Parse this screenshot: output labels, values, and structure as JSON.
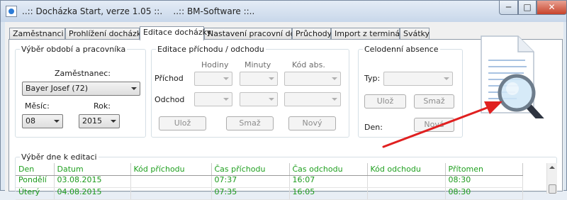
{
  "window": {
    "title": "..:: Docházka Start, verze 1.05 ::.    ..:: BM-Software ::..",
    "min_label": "─",
    "max_label": "□",
    "close_label": "✕"
  },
  "tabs": [
    {
      "label": "Zaměstnanci"
    },
    {
      "label": "Prohlížení docházky"
    },
    {
      "label": "Editace docházky",
      "active": true
    },
    {
      "label": "Nastavení pracovní doby"
    },
    {
      "label": "Průchody"
    },
    {
      "label": "Import z terminálu"
    },
    {
      "label": "Svátky"
    }
  ],
  "period_group": {
    "legend": "Výběr období a pracovníka",
    "employee_label": "Zaměstnanec:",
    "employee_value": "Bayer Josef (72)",
    "month_label": "Měsíc:",
    "month_value": "08",
    "year_label": "Rok:",
    "year_value": "2015"
  },
  "edit_group": {
    "legend": "Editace příchodu / odchodu",
    "col_hours": "Hodiny",
    "col_minutes": "Minuty",
    "col_code": "Kód abs.",
    "row_arrival": "Příchod",
    "row_departure": "Odchod",
    "save_label": "Ulož",
    "delete_label": "Smaž",
    "new_label": "Nový"
  },
  "absence_group": {
    "legend": "Celodenní absence",
    "type_label": "Typ:",
    "save_label": "Ulož",
    "delete_label": "Smaž",
    "day_label": "Den:",
    "new_label": "Nová"
  },
  "day_group": {
    "legend": "Výběr dne k editaci",
    "columns": [
      "Den",
      "Datum",
      "Kód příchodu",
      "Čas příchodu",
      "Čas odchodu",
      "Kód odchodu",
      "Přítomen"
    ],
    "rows": [
      [
        "Pondělí",
        "03.08.2015",
        "",
        "07:37",
        "16:07",
        "",
        "08:30"
      ],
      [
        "Úterý",
        "04.08.2015",
        "",
        "07:35",
        "16:05",
        "",
        "08:30"
      ]
    ]
  },
  "accent": {
    "grid_text": "#1c9a1c",
    "arrow": "#e02020"
  },
  "icons": {
    "app": "app-icon",
    "document_search": "document-magnifier-icon",
    "annotation": "red-arrow"
  }
}
